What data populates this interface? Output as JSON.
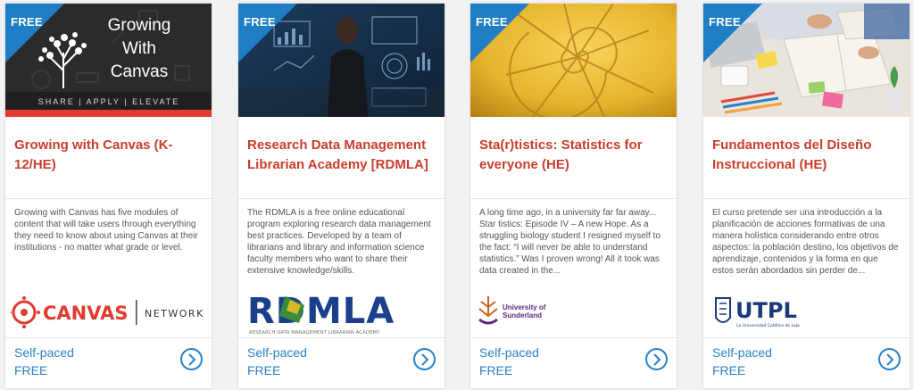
{
  "cards": [
    {
      "badge": "FREE",
      "thumb_title_lines": [
        "Growing",
        "With",
        "Canvas"
      ],
      "thumb_tagline": "SHARE | APPLY | ELEVATE",
      "title": "Growing with Canvas (K-12/HE)",
      "description": "Growing with Canvas has five modules of content that will take users through everything they need to know about using Canvas at their institutions - no matter what grade or level.",
      "logo_text": "CANVAS",
      "logo_subtext": "NETWORK",
      "pace": "Self-paced",
      "price": "FREE"
    },
    {
      "badge": "FREE",
      "title": "Research Data Management Librarian Academy [RDMLA]",
      "description": "The RDMLA is a free online educational program exploring research data management best practices. Developed by a team of librarians and library and information science faculty members who want to share their extensive knowledge/skills.",
      "logo_text": "RDMLA",
      "logo_subtext": "RESEARCH DATA MANAGEMENT LIBRARIAN ACADEMY",
      "pace": "Self-paced",
      "price": "FREE"
    },
    {
      "badge": "FREE",
      "title": "Sta(r)tistics: Statistics for everyone (HE)",
      "description": "A long time ago, in a university far far away... Star tistics: Episode IV – A new Hope. As a struggling biology student I resigned myself to the fact: “I will never be able to understand statistics.” Was I proven wrong! All it took was data created in the...",
      "logo_text": "University of Sunderland",
      "pace": "Self-paced",
      "price": "FREE"
    },
    {
      "badge": "FREE",
      "title": "Fundamentos del Diseño Instruccional (HE)",
      "description": "El curso pretende ser una introducción a la planificación de acciones formativas de una manera holística considerando entre otros aspectos: la población destino, los objetivos de aprendizaje, contenidos y la forma en que estos serán abordados sin perder de...",
      "logo_text": "UTPL",
      "logo_subtext": "La Universidad Católica de Loja",
      "pace": "Self-paced",
      "price": "FREE"
    }
  ],
  "colors": {
    "accent_blue": "#2a82c6",
    "title_red": "#c93d2b",
    "badge_blue": "#1f7ec4",
    "canvas_red": "#e13b2f"
  }
}
